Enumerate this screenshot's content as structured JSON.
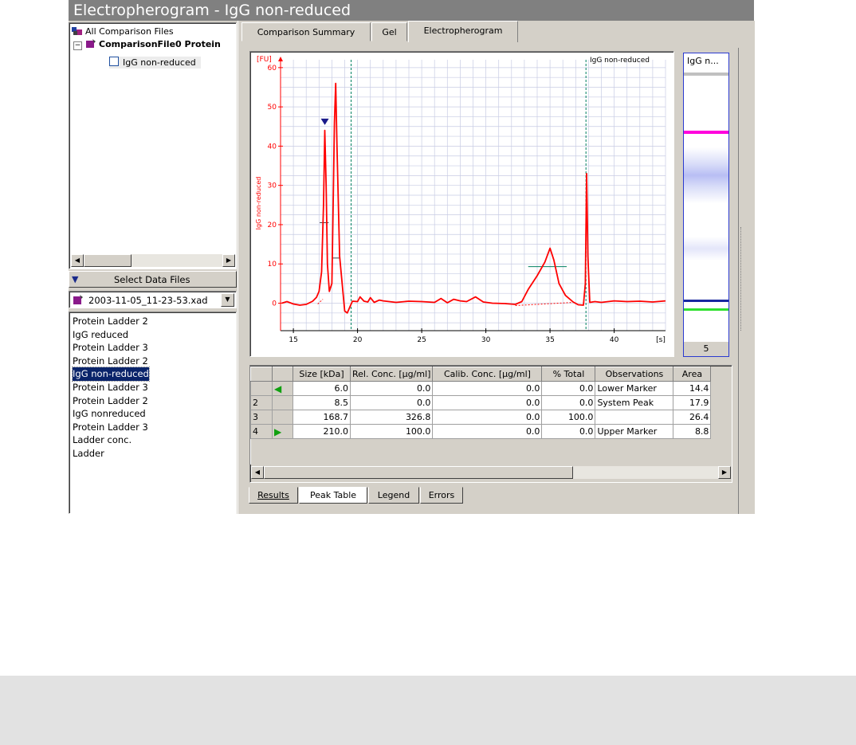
{
  "window": {
    "title": "Electropherogram - IgG non-reduced"
  },
  "tree": {
    "root": "All Comparison Files",
    "file": "ComparisonFile0 Protein",
    "sample": "IgG non-reduced"
  },
  "select_data_files": "Select Data Files",
  "file_dropdown": {
    "value": "2003-11-05_11-23-53.xad"
  },
  "samples": [
    "Protein Ladder 2",
    "IgG reduced",
    "Protein Ladder 3",
    "Protein Ladder 2",
    "IgG non-reduced",
    "Protein Ladder 3",
    "Protein Ladder 2",
    "IgG nonreduced",
    "Protein Ladder 3",
    "Ladder conc.",
    "Ladder"
  ],
  "selected_sample_index": 4,
  "tabs": [
    "Comparison Summary",
    "Gel",
    "Electropherogram"
  ],
  "active_tab": "Electropherogram",
  "chart_data": {
    "type": "line",
    "title": "IgG non-reduced",
    "ylabel": "IgG non-reduced",
    "y_unit": "[FU]",
    "x_unit": "[s]",
    "xlim": [
      14,
      44
    ],
    "ylim": [
      -7,
      62
    ],
    "x_ticks": [
      15,
      20,
      25,
      30,
      35,
      40
    ],
    "y_ticks": [
      0,
      10,
      20,
      30,
      40,
      50,
      60
    ],
    "grid": true,
    "series": [
      {
        "values_xy": [
          [
            14.1,
            0
          ],
          [
            14.5,
            0.4
          ],
          [
            15,
            -0.2
          ],
          [
            15.5,
            -0.5
          ],
          [
            16,
            -0.3
          ],
          [
            16.5,
            0.5
          ],
          [
            16.8,
            1.5
          ],
          [
            17.0,
            3
          ],
          [
            17.2,
            8
          ],
          [
            17.35,
            25
          ],
          [
            17.45,
            44
          ],
          [
            17.55,
            30
          ],
          [
            17.65,
            10
          ],
          [
            17.8,
            3
          ],
          [
            18.0,
            5
          ],
          [
            18.1,
            25
          ],
          [
            18.2,
            46
          ],
          [
            18.3,
            56
          ],
          [
            18.4,
            40
          ],
          [
            18.6,
            12
          ],
          [
            18.8,
            5
          ],
          [
            19.0,
            -2
          ],
          [
            19.2,
            -2.5
          ],
          [
            19.4,
            -1
          ],
          [
            19.6,
            0.5
          ],
          [
            20,
            0.4
          ],
          [
            20.2,
            1.6
          ],
          [
            20.5,
            0.5
          ],
          [
            20.8,
            0.3
          ],
          [
            21,
            1.4
          ],
          [
            21.3,
            0.2
          ],
          [
            21.7,
            0.8
          ],
          [
            22,
            0.6
          ],
          [
            23,
            0.2
          ],
          [
            24,
            0.5
          ],
          [
            25,
            0.4
          ],
          [
            26,
            0.2
          ],
          [
            26.5,
            1.2
          ],
          [
            27,
            0.1
          ],
          [
            27.5,
            1
          ],
          [
            28,
            0.6
          ],
          [
            28.5,
            0.4
          ],
          [
            29.2,
            1.6
          ],
          [
            29.8,
            0.3
          ],
          [
            30.5,
            0
          ],
          [
            31.5,
            -0.1
          ],
          [
            32.3,
            -0.3
          ],
          [
            32.8,
            0.4
          ],
          [
            33.3,
            3.5
          ],
          [
            34,
            7
          ],
          [
            34.6,
            10.5
          ],
          [
            35.0,
            14
          ],
          [
            35.3,
            11
          ],
          [
            35.7,
            5
          ],
          [
            36.2,
            2
          ],
          [
            36.8,
            0.3
          ],
          [
            37.2,
            -0.4
          ],
          [
            37.6,
            -0.5
          ],
          [
            37.75,
            5
          ],
          [
            37.85,
            33
          ],
          [
            37.95,
            12
          ],
          [
            38.1,
            0.2
          ],
          [
            38.5,
            0.4
          ],
          [
            39,
            0.2
          ],
          [
            40,
            0.6
          ],
          [
            41,
            0.4
          ],
          [
            42,
            0.5
          ],
          [
            43,
            0.3
          ],
          [
            44,
            0.6
          ]
        ]
      }
    ],
    "markers": [
      {
        "type": "lower-marker-triangle",
        "x": 17.45,
        "y": 46
      },
      {
        "type": "vline",
        "x": 19.5
      },
      {
        "type": "vline",
        "x": 37.8
      }
    ]
  },
  "gel_lane": {
    "label": "IgG n...",
    "lane_number": "5"
  },
  "peak_table": {
    "columns": [
      "",
      "",
      "Size [kDa]",
      "Rel. Conc. [µg/ml]",
      "Calib. Conc. [µg/ml]",
      "% Total",
      "Observations",
      "Area"
    ],
    "rows": [
      {
        "id": "",
        "marker": "lower",
        "size": "6.0",
        "rel": "0.0",
        "calib": "0.0",
        "pct": "0.0",
        "obs": "Lower Marker",
        "area": "14.4"
      },
      {
        "id": "2",
        "marker": "",
        "size": "8.5",
        "rel": "0.0",
        "calib": "0.0",
        "pct": "0.0",
        "obs": "System Peak",
        "area": "17.9"
      },
      {
        "id": "3",
        "marker": "",
        "size": "168.7",
        "rel": "326.8",
        "calib": "0.0",
        "pct": "100.0",
        "obs": "",
        "area": "26.4"
      },
      {
        "id": "4",
        "marker": "upper",
        "size": "210.0",
        "rel": "100.0",
        "calib": "0.0",
        "pct": "0.0",
        "obs": "Upper Marker",
        "area": "8.8"
      }
    ]
  },
  "bottom_tabs": [
    "Results",
    "Peak Table",
    "Legend",
    "Errors"
  ],
  "active_bottom_tab": "Peak Table",
  "colors": {
    "trace": "#ff0000",
    "grid": "#c8cce4",
    "marker_line": "#008060",
    "lower_marker_band": "#ff00ff"
  }
}
